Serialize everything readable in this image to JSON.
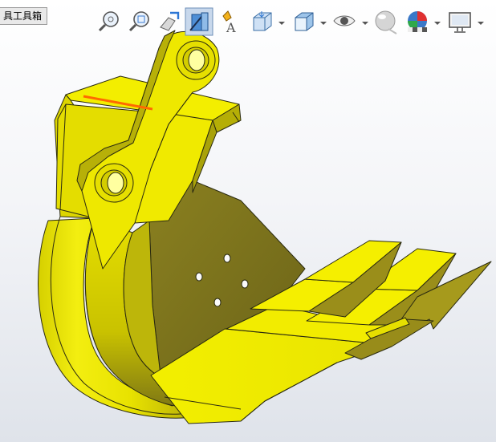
{
  "tabs": {
    "toolbox_label": "具工具箱"
  },
  "toolbar": {
    "items": [
      {
        "name": "zoom-to-fit",
        "icon": "zoom-fit-icon"
      },
      {
        "name": "zoom-to-area",
        "icon": "zoom-area-icon"
      },
      {
        "name": "previous-view",
        "icon": "previous-view-icon"
      },
      {
        "name": "section-view",
        "icon": "section-view-icon",
        "active": true
      },
      {
        "name": "dynamic-annotation",
        "icon": "annotation-icon"
      },
      {
        "name": "view-orientation",
        "icon": "view-orientation-icon",
        "dropdown": true
      },
      {
        "name": "display-style",
        "icon": "display-style-icon",
        "dropdown": true
      },
      {
        "name": "hide-show-items",
        "icon": "eye-icon",
        "dropdown": true
      },
      {
        "name": "edit-appearance",
        "icon": "appearance-sphere-icon"
      },
      {
        "name": "apply-scene",
        "icon": "scene-icon",
        "dropdown": true
      },
      {
        "name": "view-settings",
        "icon": "monitor-icon",
        "dropdown": true
      }
    ]
  },
  "colors": {
    "model_bright": "#f0ea00",
    "model_mid": "#d8d200",
    "model_dark": "#9a8e1a",
    "model_shadow": "#6e6418",
    "edge": "#2a2a10",
    "highlight_edge": "#ff6a00",
    "toolbar_active_bg": "#c8d8ec"
  }
}
